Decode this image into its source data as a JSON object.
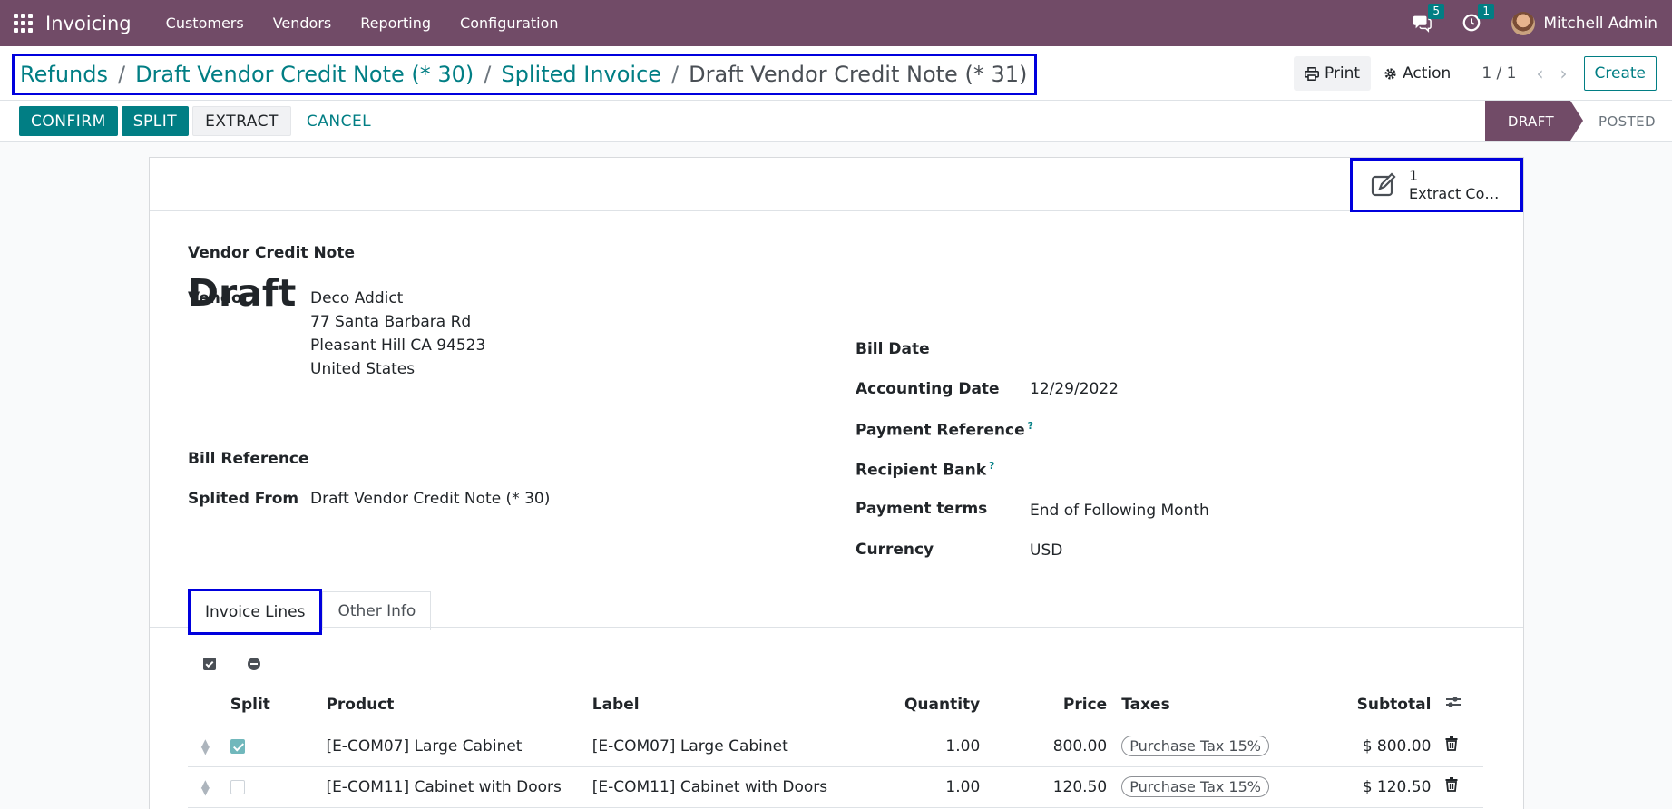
{
  "navbar": {
    "app_name": "Invoicing",
    "menu": [
      "Customers",
      "Vendors",
      "Reporting",
      "Configuration"
    ],
    "messages_count": "5",
    "activities_count": "1",
    "user_name": "Mitchell Admin",
    "brand_color": "#714b67"
  },
  "breadcrumb": {
    "items": [
      "Refunds",
      "Draft Vendor Credit Note (* 30)",
      "Splited Invoice"
    ],
    "current": "Draft Vendor Credit Note (* 31)",
    "separator": "/"
  },
  "control": {
    "print_label": "Print",
    "action_label": "Action",
    "pager": "1 / 1",
    "create_label": "Create"
  },
  "statusbar": {
    "buttons": [
      "CONFIRM",
      "SPLIT",
      "EXTRACT",
      "CANCEL"
    ],
    "stages": [
      "DRAFT",
      "POSTED"
    ],
    "active_stage": "DRAFT"
  },
  "smart_button": {
    "count": "1",
    "label": "Extract Co…",
    "icon": "edit-document-icon"
  },
  "form": {
    "doc_type": "Vendor Credit Note",
    "title": "Draft",
    "left_fields": {
      "vendor_label": "Vendor",
      "vendor_address": [
        "Deco Addict",
        "77 Santa Barbara Rd",
        "Pleasant Hill CA 94523",
        "United States"
      ],
      "bill_reference_label": "Bill Reference",
      "splited_from_label": "Splited From",
      "splited_from_value": "Draft Vendor Credit Note (* 30)"
    },
    "right_fields": {
      "bill_date_label": "Bill Date",
      "accounting_date_label": "Accounting Date",
      "accounting_date_value": "12/29/2022",
      "payment_reference_label": "Payment Reference",
      "recipient_bank_label": "Recipient Bank",
      "payment_terms_label": "Payment terms",
      "payment_terms_value": "End of Following Month",
      "currency_label": "Currency",
      "currency_value": "USD",
      "help_mark": "?"
    }
  },
  "tabs": [
    "Invoice Lines",
    "Other Info"
  ],
  "table": {
    "headers": {
      "split": "Split",
      "product": "Product",
      "label": "Label",
      "quantity": "Quantity",
      "price": "Price",
      "taxes": "Taxes",
      "subtotal": "Subtotal"
    },
    "rows": [
      {
        "split": true,
        "product": "[E-COM07] Large Cabinet",
        "label": "[E-COM07] Large Cabinet",
        "quantity": "1.00",
        "price": "800.00",
        "taxes": "Purchase Tax 15%",
        "subtotal": "$ 800.00"
      },
      {
        "split": false,
        "product": "[E-COM11] Cabinet with Doors",
        "label": "[E-COM11] Cabinet with Doors",
        "quantity": "1.00",
        "price": "120.50",
        "taxes": "Purchase Tax 15%",
        "subtotal": "$ 120.50"
      }
    ]
  }
}
